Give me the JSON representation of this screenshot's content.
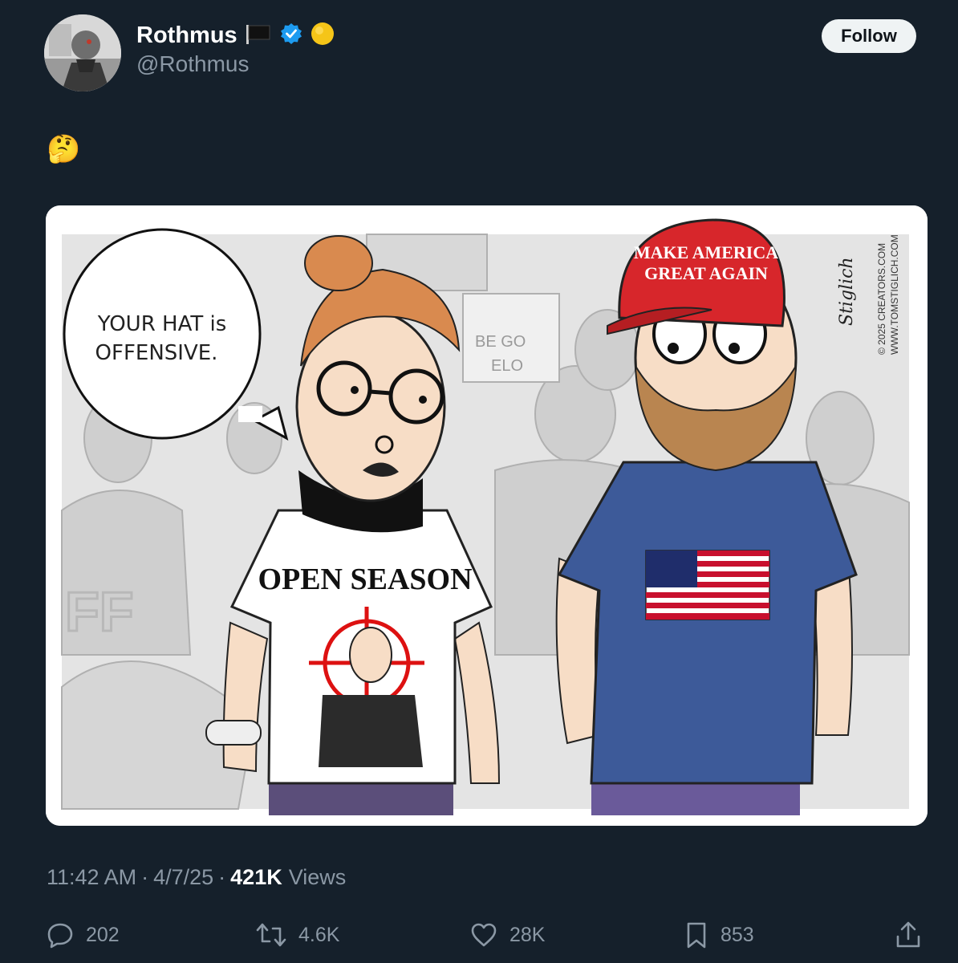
{
  "author": {
    "display_name": "Rothmus",
    "handle": "@Rothmus",
    "badges": [
      "black-flag-icon",
      "verified-badge-icon",
      "yellow-circle-icon"
    ]
  },
  "follow_label": "Follow",
  "tweet_text": "🤔",
  "media": {
    "speech_bubble_line1": "YOUR HAT is",
    "speech_bubble_line2": "OFFENSIVE.",
    "hat_line1": "MAKE AMERICA",
    "hat_line2": "GREAT AGAIN",
    "shirt_text": "OPEN SEASON",
    "sign_line1": "BE GO",
    "sign_line2": "ELO",
    "signature": "Stiglich",
    "copyright_line1": "© 2025 CREATORS.COM",
    "copyright_line2": "WWW.TOMSTIGLICH.COM"
  },
  "meta": {
    "time": "11:42 AM",
    "date": "4/7/25",
    "views_count": "421K",
    "views_label": "Views"
  },
  "actions": {
    "replies": "202",
    "reposts": "4.6K",
    "likes": "28K",
    "bookmarks": "853"
  },
  "colors": {
    "background": "#15202b",
    "secondary_text": "#8b98a5",
    "verified_blue": "#1d9bf0",
    "hat_red": "#d7262b",
    "shirt_blue": "#3d5a99"
  }
}
